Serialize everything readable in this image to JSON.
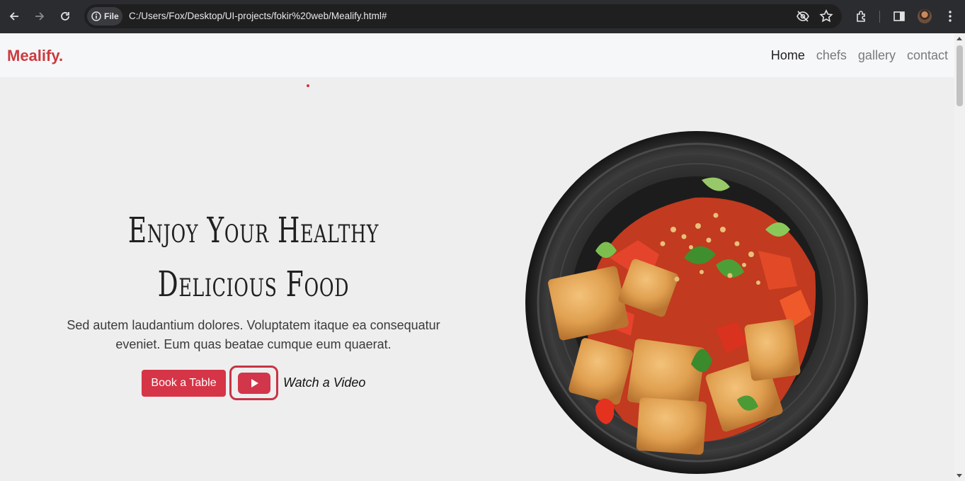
{
  "browser": {
    "back_icon": "arrow-left-icon",
    "forward_icon": "arrow-right-icon",
    "reload_icon": "reload-icon",
    "address": {
      "chip_label": "File",
      "url": "C:/Users/Fox/Desktop/UI-projects/fokir%20web/Mealify.html#"
    }
  },
  "header": {
    "logo": "Mealify.",
    "nav": [
      {
        "label": "Home",
        "active": true
      },
      {
        "label": "chefs",
        "active": false
      },
      {
        "label": "gallery",
        "active": false
      },
      {
        "label": "contact",
        "active": false
      }
    ]
  },
  "hero": {
    "title_line1": "Enjoy Your Healthy",
    "title_line2": "Delicious Food",
    "text_line1": "Sed autem laudantium dolores. Voluptatem itaque ea consequatur",
    "text_line2": "eveniet. Eum quas beatae cumque eum quaerat.",
    "book_button": "Book a Table",
    "watch_video": "Watch a Video"
  },
  "colors": {
    "brand": "#cc3b3f",
    "button": "#d63447",
    "background": "#eeeeee",
    "header_bg": "#f6f7f9"
  }
}
